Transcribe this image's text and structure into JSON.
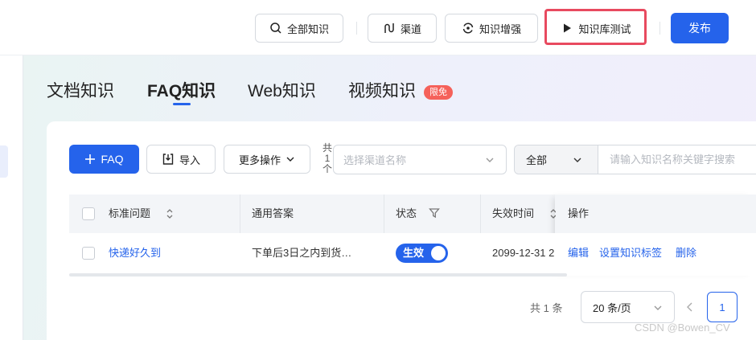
{
  "header": {
    "all_knowledge": "全部知识",
    "channel": "渠道",
    "enhance": "知识增强",
    "kb_test": "知识库测试",
    "publish": "发布"
  },
  "tabs": [
    {
      "label": "文档知识",
      "active": false
    },
    {
      "label": "FAQ知识",
      "active": true
    },
    {
      "label": "Web知识",
      "active": false
    },
    {
      "label": "视频知识",
      "active": false,
      "badge": "限免"
    }
  ],
  "toolbar": {
    "add_faq": "FAQ",
    "import": "导入",
    "more_actions": "更多操作",
    "total_label_1": "共",
    "total_count": "1",
    "total_label_2": "个",
    "channel_placeholder": "选择渠道名称",
    "scope_value": "全部",
    "search_placeholder": "请输入知识名称关键字搜索"
  },
  "table": {
    "columns": [
      "标准问题",
      "通用答案",
      "状态",
      "失效时间",
      "操作"
    ],
    "rows": [
      {
        "question": "快递好久到",
        "answer": "下单后3日之内到货…",
        "status": "生效",
        "expiry": "2099-12-31 2",
        "actions": [
          "编辑",
          "设置知识标签",
          "删除"
        ]
      }
    ]
  },
  "pagination": {
    "total": "共 1 条",
    "page_size": "20 条/页",
    "current_page": "1"
  },
  "watermark": "CSDN @Bowen_CV",
  "colors": {
    "primary": "#2563eb",
    "highlight": "#e84a5f",
    "badge": "#f5615a"
  }
}
